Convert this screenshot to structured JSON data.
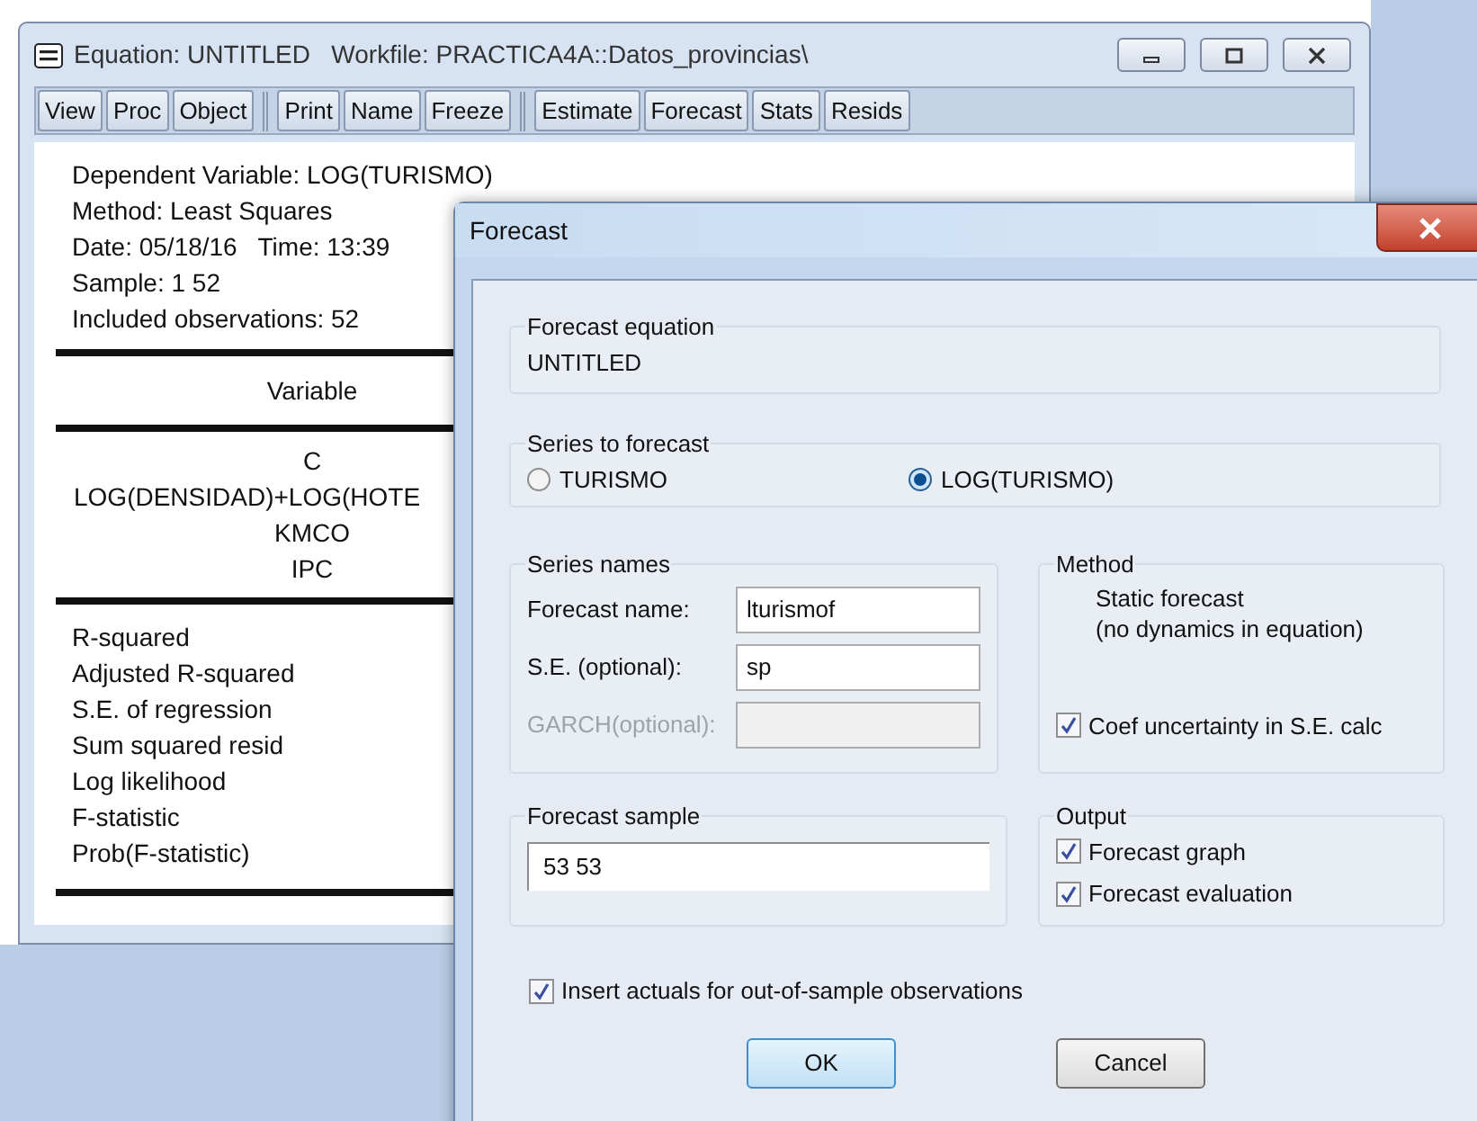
{
  "equation_window": {
    "title": "Equation: UNTITLED   Workfile: PRACTICA4A::Datos_provincias\\",
    "toolbar": [
      [
        "View",
        "Proc",
        "Object"
      ],
      [
        "Print",
        "Name",
        "Freeze"
      ],
      [
        "Estimate",
        "Forecast",
        "Stats",
        "Resids"
      ]
    ],
    "header_lines": [
      "Dependent Variable: LOG(TURISMO)",
      "Method: Least Squares",
      "Date: 05/18/16   Time: 13:39",
      "Sample: 1 52",
      "Included observations: 52"
    ],
    "variable_heading": "Variable",
    "variables": [
      "C",
      "LOG(DENSIDAD)+LOG(HOTE",
      "KMCO",
      "IPC"
    ],
    "statistics": [
      "R-squared",
      "Adjusted R-squared",
      "S.E. of regression",
      "Sum squared resid",
      "Log likelihood",
      "F-statistic",
      "Prob(F-statistic)"
    ]
  },
  "forecast_dialog": {
    "title": "Forecast",
    "forecast_equation": {
      "label": "Forecast equation",
      "value": "UNTITLED"
    },
    "series_to_forecast": {
      "label": "Series to forecast",
      "options": [
        {
          "label": "TURISMO",
          "selected": false
        },
        {
          "label": "LOG(TURISMO)",
          "selected": true
        }
      ]
    },
    "series_names": {
      "label": "Series names",
      "fields": [
        {
          "label": "Forecast name:",
          "value": "lturismof",
          "disabled": false
        },
        {
          "label": "S.E. (optional):",
          "value": "sp",
          "disabled": false
        },
        {
          "label": "GARCH(optional):",
          "disabled": true
        }
      ]
    },
    "method": {
      "label": "Method",
      "lines": [
        "Static forecast",
        "(no dynamics in equation)"
      ],
      "checkbox": {
        "label": "Coef uncertainty in S.E. calc",
        "checked": true
      }
    },
    "forecast_sample": {
      "label": "Forecast sample",
      "value": "53 53"
    },
    "output": {
      "label": "Output",
      "options": [
        {
          "label": "Forecast graph",
          "checked": true
        },
        {
          "label": "Forecast evaluation",
          "checked": true
        }
      ]
    },
    "insert_actuals": {
      "label": "Insert actuals for out-of-sample observations",
      "checked": true
    },
    "buttons": [
      {
        "label": "OK",
        "default": true
      },
      {
        "label": "Cancel",
        "default": false
      }
    ]
  }
}
